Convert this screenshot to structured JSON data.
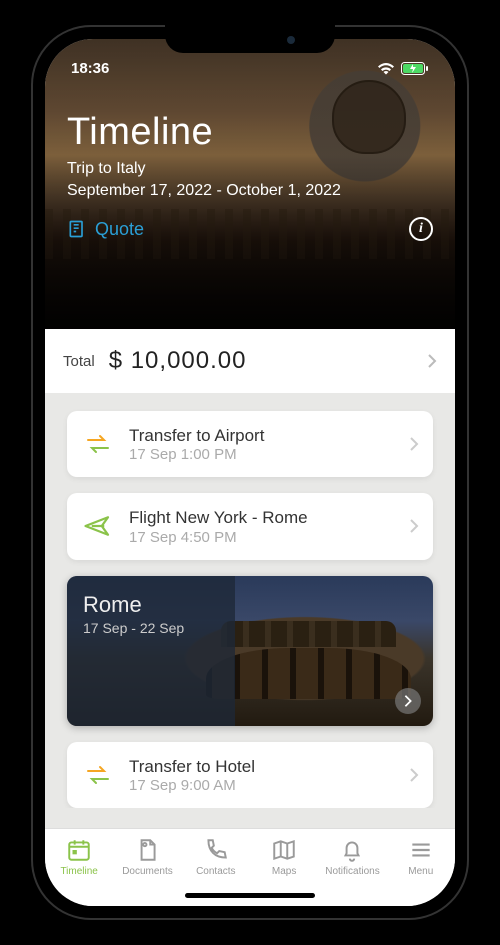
{
  "status": {
    "time": "18:36"
  },
  "hero": {
    "title": "Timeline",
    "trip_name": "Trip to Italy",
    "date_range": "September 17, 2022 - October 1, 2022",
    "quote_label": "Quote"
  },
  "total": {
    "label": "Total",
    "amount": "$ 10,000.00"
  },
  "cards": [
    {
      "icon": "transfer",
      "title": "Transfer to Airport",
      "sub": "17 Sep 1:00 PM"
    },
    {
      "icon": "flight",
      "title": "Flight New York - Rome",
      "sub": "17 Sep 4:50 PM"
    }
  ],
  "destination": {
    "title": "Rome",
    "sub": "17 Sep - 22 Sep"
  },
  "cards2": [
    {
      "icon": "transfer",
      "title": "Transfer to Hotel",
      "sub": "17 Sep 9:00 AM"
    }
  ],
  "tabs": [
    {
      "label": "Timeline",
      "icon": "calendar",
      "active": true
    },
    {
      "label": "Documents",
      "icon": "documents",
      "active": false
    },
    {
      "label": "Contacts",
      "icon": "phone",
      "active": false
    },
    {
      "label": "Maps",
      "icon": "map",
      "active": false
    },
    {
      "label": "Notifications",
      "icon": "bell",
      "active": false
    },
    {
      "label": "Menu",
      "icon": "menu",
      "active": false
    }
  ]
}
